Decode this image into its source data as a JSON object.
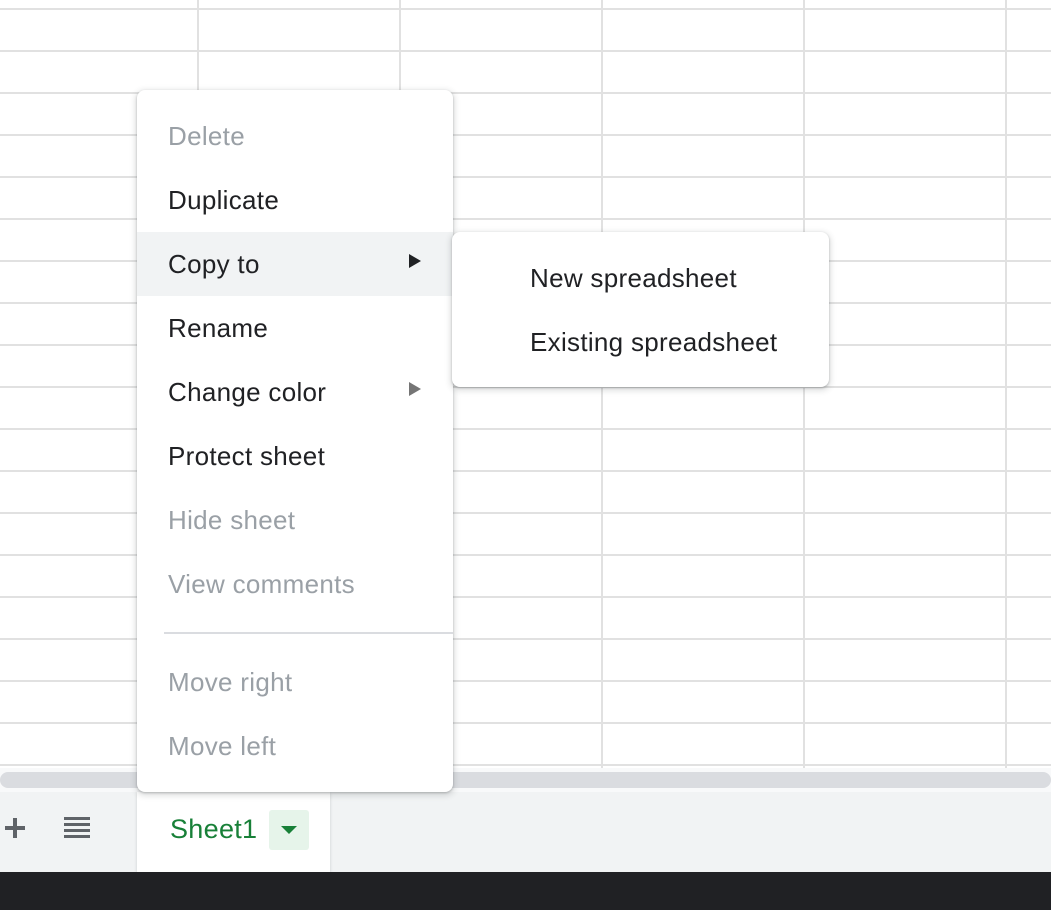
{
  "context_menu": {
    "items": [
      {
        "label": "Delete",
        "enabled": false
      },
      {
        "label": "Duplicate",
        "enabled": true
      },
      {
        "label": "Copy to",
        "enabled": true,
        "submenu": true,
        "highlighted": true
      },
      {
        "label": "Rename",
        "enabled": true
      },
      {
        "label": "Change color",
        "enabled": true,
        "submenu": true
      },
      {
        "label": "Protect sheet",
        "enabled": true
      },
      {
        "label": "Hide sheet",
        "enabled": false
      },
      {
        "label": "View comments",
        "enabled": false
      },
      {
        "label": "Move right",
        "enabled": false
      },
      {
        "label": "Move left",
        "enabled": false
      }
    ]
  },
  "copy_to_submenu": {
    "items": [
      {
        "label": "New spreadsheet"
      },
      {
        "label": "Existing spreadsheet"
      }
    ]
  },
  "sheet_bar": {
    "add_icon": "plus-icon",
    "all_sheets_icon": "list-icon",
    "tabs": [
      {
        "label": "Sheet1",
        "active": true,
        "dropdown_icon": "caret-down-icon"
      }
    ]
  },
  "colors": {
    "active_tab_text": "#188038",
    "tab_dropdown_bg": "#e6f4ea",
    "disabled_text": "#9aa0a6",
    "enabled_text": "#202124",
    "highlight_bg": "#f1f3f4"
  }
}
